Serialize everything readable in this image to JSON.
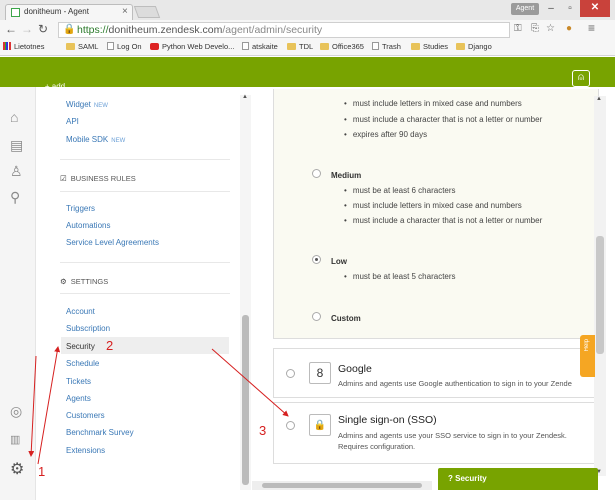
{
  "browser": {
    "tab_title": "donitheum - Agent",
    "tab_close": "×",
    "profile_label": "Agent",
    "window": {
      "minimize": "–",
      "maximize": "▫",
      "close": "✕"
    },
    "url_scheme": "https://",
    "url_host": "donitheum.zendesk.com",
    "url_path": "/agent/admin/security",
    "bookmarks": [
      "Lietotnes",
      "SAML",
      "Log On",
      "Python Web Develo...",
      "atskaite",
      "TDL",
      "Office365",
      "Trash",
      "Studies",
      "Django"
    ]
  },
  "zendesk": {
    "add_button": "+ add",
    "admin_nav": {
      "channel_links": [
        {
          "label": "Widget",
          "badge": "NEW"
        },
        {
          "label": "API",
          "badge": ""
        },
        {
          "label": "Mobile SDK",
          "badge": "NEW"
        }
      ],
      "business_rules_heading": "BUSINESS RULES",
      "business_rules": [
        "Triggers",
        "Automations",
        "Service Level Agreements"
      ],
      "settings_heading": "SETTINGS",
      "settings": [
        "Account",
        "Subscription",
        "Security",
        "Schedule",
        "Tickets",
        "Agents",
        "Customers",
        "Benchmark Survey",
        "Extensions"
      ],
      "selected": "Security"
    },
    "password_policy": {
      "high_rules_visible": [
        "must include letters in mixed case and numbers",
        "must include a character that is not a letter or number",
        "expires after 90 days"
      ],
      "medium": {
        "label": "Medium",
        "rules": [
          "must be at least 6 characters",
          "must include letters in mixed case and numbers",
          "must include a character that is not a letter or number"
        ]
      },
      "low": {
        "label": "Low",
        "rules": [
          "must be at least 5 characters"
        ],
        "selected": true
      },
      "custom": {
        "label": "Custom"
      }
    },
    "auth_options": {
      "google": {
        "title": "Google",
        "description": "Admins and agents use Google authentication to sign in to your Zende"
      },
      "sso": {
        "title": "Single sign-on (SSO)",
        "description_line1": "Admins and agents use your SSO service to sign in to your Zendesk.",
        "description_line2": "Requires configuration."
      }
    },
    "help_tab": "Help",
    "bottom_bar": "? Security"
  },
  "annotations": {
    "one": "1",
    "two": "2",
    "three": "3"
  },
  "colors": {
    "zendesk_green": "#78a300",
    "annotation_red": "#d62020",
    "help_orange": "#f5a623"
  }
}
